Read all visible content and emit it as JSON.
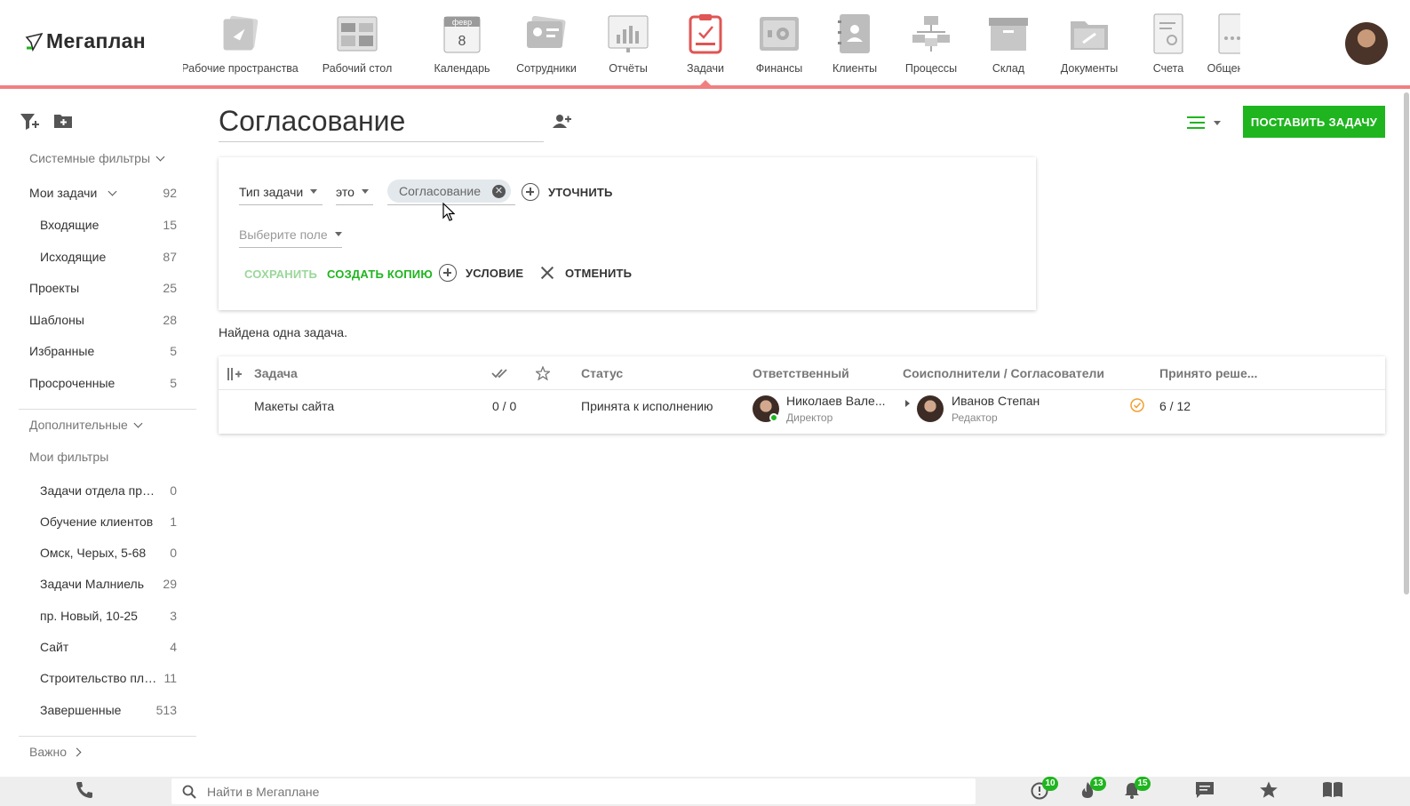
{
  "app": {
    "logo_text": "Мегаплан"
  },
  "nav": [
    {
      "label": "Рабочие пространства",
      "icon": "workspaces-icon"
    },
    {
      "label": "Рабочий стол",
      "icon": "desktop-icon"
    },
    {
      "label": "Календарь",
      "icon": "calendar-icon",
      "month": "февр",
      "day": "8"
    },
    {
      "label": "Сотрудники",
      "icon": "employees-icon"
    },
    {
      "label": "Отчёты",
      "icon": "reports-icon"
    },
    {
      "label": "Задачи",
      "icon": "tasks-icon",
      "active": true
    },
    {
      "label": "Финансы",
      "icon": "finance-icon"
    },
    {
      "label": "Клиенты",
      "icon": "clients-icon"
    },
    {
      "label": "Процессы",
      "icon": "processes-icon"
    },
    {
      "label": "Склад",
      "icon": "warehouse-icon"
    },
    {
      "label": "Документы",
      "icon": "documents-icon"
    },
    {
      "label": "Счета",
      "icon": "invoices-icon"
    },
    {
      "label": "Общение",
      "icon": "chat-icon"
    }
  ],
  "sidebar": {
    "system_filters": "Системные фильтры",
    "my_tasks": {
      "label": "Мои задачи",
      "count": "92"
    },
    "incoming": {
      "label": "Входящие",
      "count": "15"
    },
    "outgoing": {
      "label": "Исходящие",
      "count": "87"
    },
    "items": [
      {
        "label": "Проекты",
        "count": "25"
      },
      {
        "label": "Шаблоны",
        "count": "28"
      },
      {
        "label": "Избранные",
        "count": "5"
      },
      {
        "label": "Просроченные",
        "count": "5"
      }
    ],
    "additional": "Дополнительные",
    "my_filters": "Мои фильтры",
    "filters": [
      {
        "label": "Задачи отдела продаж",
        "count": "0"
      },
      {
        "label": "Обучение клиентов",
        "count": "1"
      },
      {
        "label": "Омск, Черых, 5-68",
        "count": "0"
      },
      {
        "label": "Задачи Малниель",
        "count": "29"
      },
      {
        "label": "пр. Новый, 10-25",
        "count": "3"
      },
      {
        "label": "Сайт",
        "count": "4"
      },
      {
        "label": "Строительство площадки",
        "count": "11"
      },
      {
        "label": "Завершенные",
        "count": "513"
      }
    ],
    "important": "Важно"
  },
  "page": {
    "title": "Согласование",
    "create_button": "ПОСТАВИТЬ ЗАДАЧУ"
  },
  "filter": {
    "field": "Тип задачи",
    "operator": "это",
    "value_chip": "Согласование",
    "refine": "УТОЧНИТЬ",
    "choose_field_placeholder": "Выберите поле",
    "save": "СОХРАНИТЬ",
    "copy": "СОЗДАТЬ КОПИЮ",
    "condition": "УСЛОВИЕ",
    "cancel": "ОТМЕНИТЬ"
  },
  "results_text": "Найдена одна задача.",
  "table": {
    "columns": [
      "Задача",
      "Статус",
      "Ответственный",
      "Соисполнители / Согласователи",
      "Принято реше..."
    ],
    "rows": [
      {
        "task": "Макеты сайта",
        "checks": "0 / 0",
        "status": "Принята к исполнению",
        "responsible_name": "Николаев Вале...",
        "responsible_role": "Директор",
        "coexecutor_name": "Иванов Степан",
        "coexecutor_role": "Редактор",
        "decisions": "6 / 12"
      }
    ]
  },
  "bottom": {
    "search_placeholder": "Найти в Мегаплане",
    "badges": {
      "alerts": "10",
      "hot": "13",
      "notifications": "15"
    }
  },
  "colors": {
    "accent": "#1fb51f",
    "nav_underline": "#f08080",
    "active_tasks": "#e05555"
  }
}
